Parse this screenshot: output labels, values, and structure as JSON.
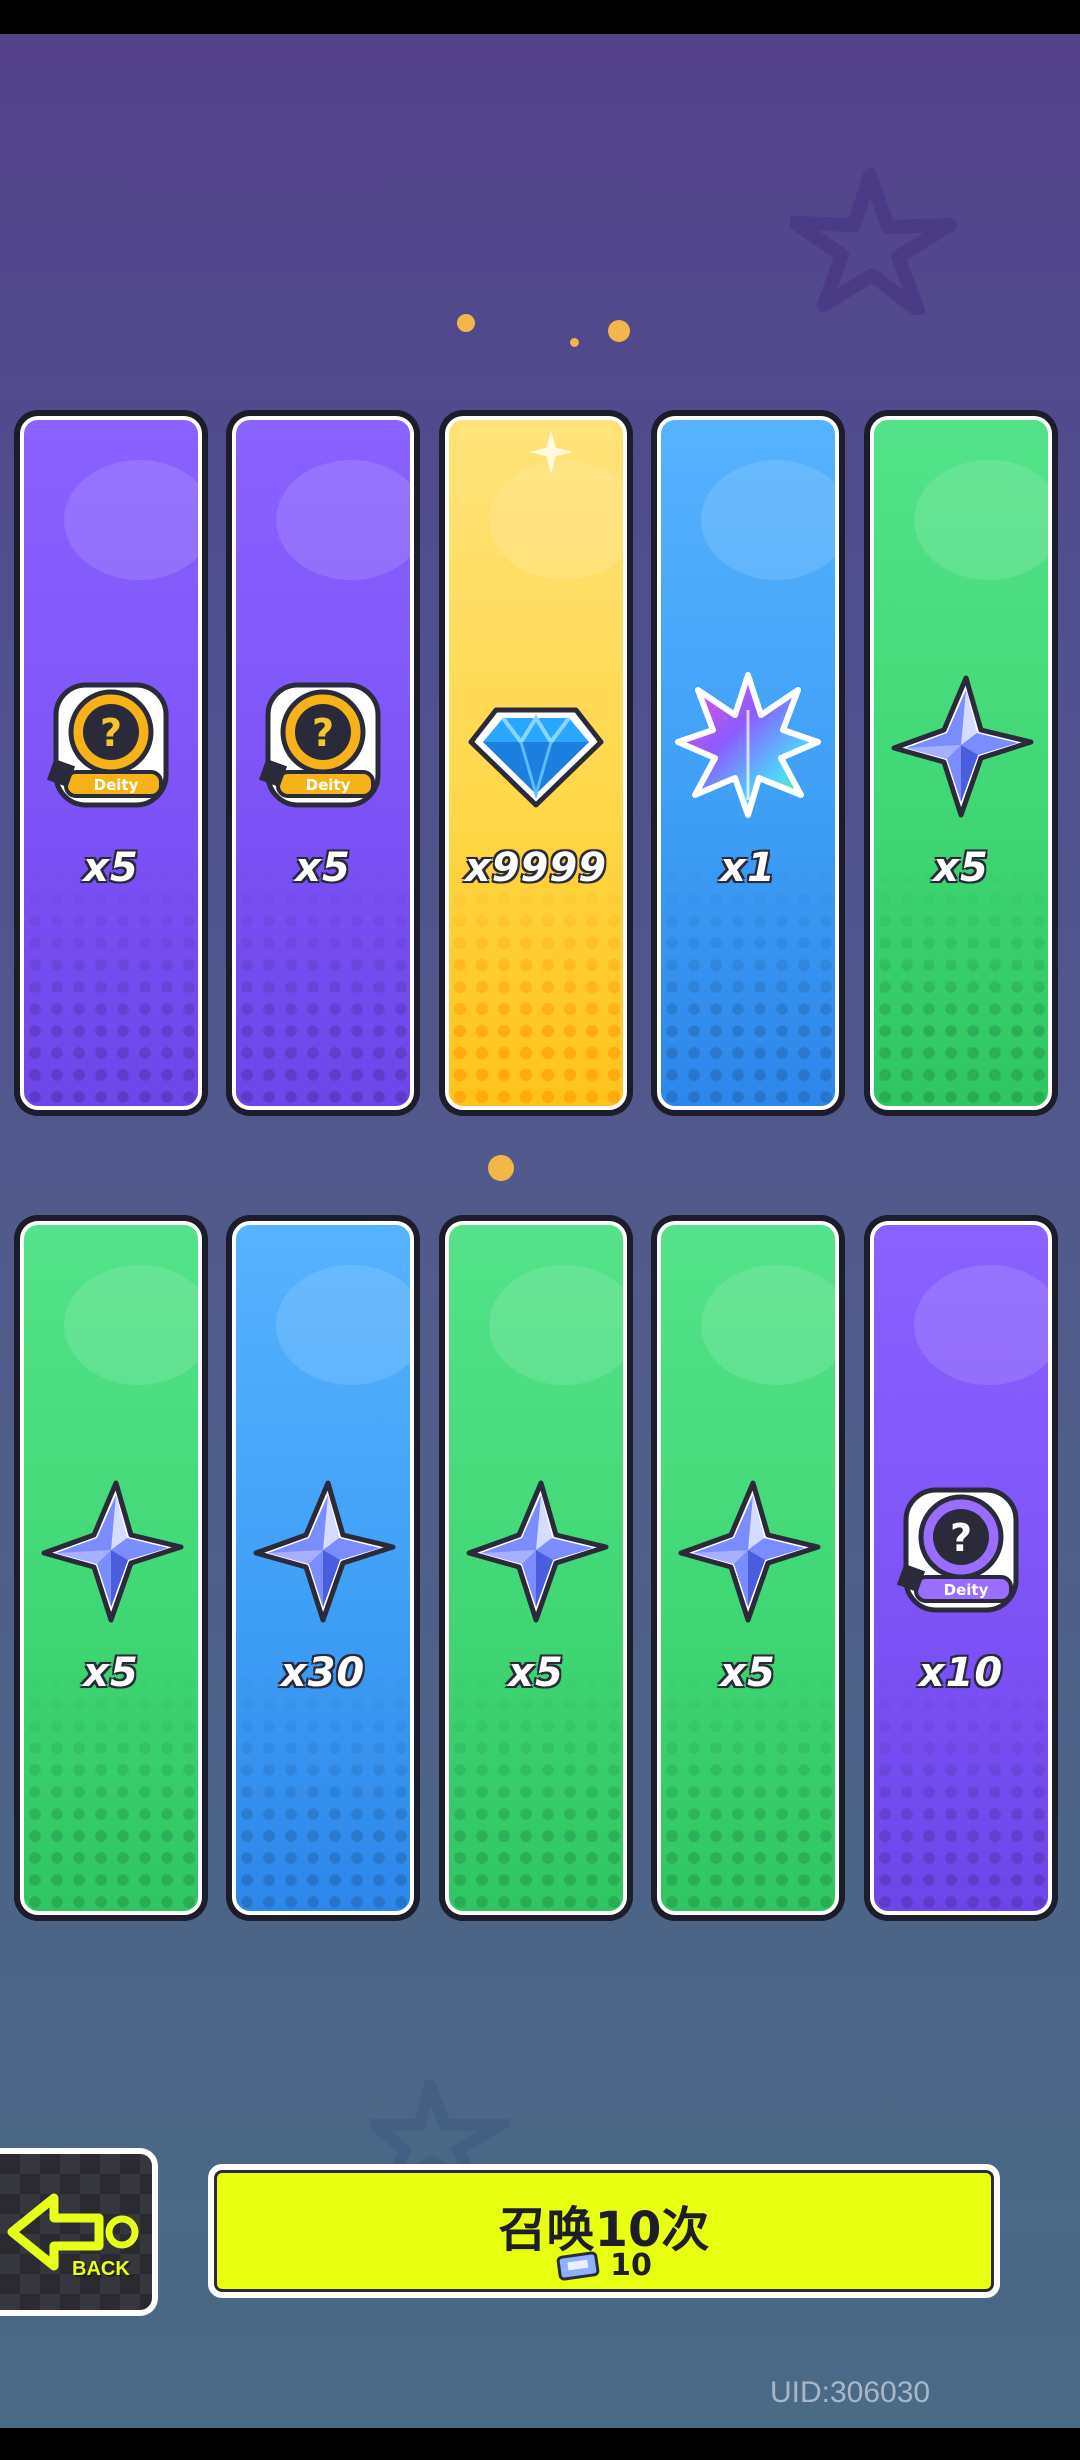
{
  "rewards": [
    {
      "color": "purple",
      "icon": "mystery-deity-badge-icon",
      "qty": "x5"
    },
    {
      "color": "purple",
      "icon": "mystery-deity-badge-icon",
      "qty": "x5"
    },
    {
      "color": "gold",
      "icon": "blue-diamond-gem-icon",
      "qty": "x9999"
    },
    {
      "color": "blue",
      "icon": "rainbow-leaf-icon",
      "qty": "x1"
    },
    {
      "color": "green",
      "icon": "four-point-star-shard-icon",
      "qty": "x5"
    },
    {
      "color": "green",
      "icon": "four-point-star-shard-icon",
      "qty": "x5"
    },
    {
      "color": "blue",
      "icon": "four-point-star-shard-icon",
      "qty": "x30"
    },
    {
      "color": "green",
      "icon": "four-point-star-shard-icon",
      "qty": "x5"
    },
    {
      "color": "green",
      "icon": "four-point-star-shard-icon",
      "qty": "x5"
    },
    {
      "color": "purple",
      "icon": "mystery-deity-badge-purple-icon",
      "qty": "x10"
    }
  ],
  "badge_text": "Deity",
  "back_button": {
    "label": "BACK",
    "icon": "arrow-left-icon"
  },
  "summon_button": {
    "title": "召唤10次",
    "ticket_icon": "summon-ticket-icon",
    "cost": "10",
    "color": "#e9ff10"
  },
  "uid": "UID:306030"
}
